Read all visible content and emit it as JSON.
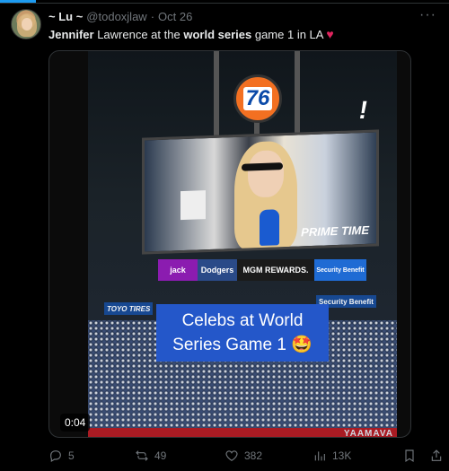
{
  "tweet": {
    "display_name": "~ Lu ~",
    "handle": "@todoxjlaw",
    "separator": "·",
    "date": "Oct 26",
    "more_label": "···",
    "text_bold_1": "Jennifer",
    "text_part_1": "Lawrence at the",
    "text_bold_2": "world series",
    "text_part_2": "game 1 in LA",
    "heart": "♥"
  },
  "video": {
    "timer": "0:04",
    "overlay_title": "Celebs at World Series Game 1 🤩",
    "scoreboard_logo": "76",
    "exclaim": "!",
    "prime_time": "PRIME TIME",
    "ads": [
      "jack",
      "Dodgers",
      "MGM REWARDS.",
      "Security Benefit"
    ],
    "signs": [
      "TOYO TIRES",
      "Security Benefit"
    ],
    "stadium_sign": "YAAMAVA"
  },
  "actions": {
    "replies": "5",
    "reposts": "49",
    "likes": "382",
    "views": "13K"
  },
  "colors": {
    "accent": "#1d9bf0",
    "heart": "#e0245e",
    "banner": "#2457c9"
  }
}
